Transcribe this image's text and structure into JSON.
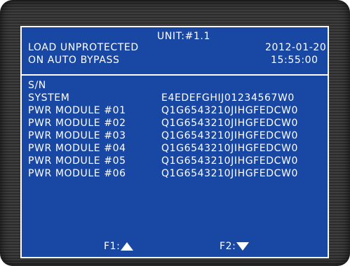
{
  "header": {
    "unit": "UNIT:#1.1",
    "alarm_line1": "LOAD UNPROTECTED",
    "alarm_line2": "ON AUTO BYPASS",
    "date": "2012-01-20",
    "time": "15:55:00"
  },
  "serial_list": {
    "title": "S/N",
    "rows": [
      {
        "label": "SYSTEM",
        "value": "E4EDEFGHIJ01234567W0"
      },
      {
        "label": "PWR MODULE #01",
        "value": "Q1G6543210JIHGFEDCW0"
      },
      {
        "label": "PWR MODULE #02",
        "value": "Q1G6543210JIHGFEDCW0"
      },
      {
        "label": "PWR MODULE #03",
        "value": "Q1G6543210JIHGFEDCW0"
      },
      {
        "label": "PWR MODULE #04",
        "value": "Q1G6543210JIHGFEDCW0"
      },
      {
        "label": "PWR MODULE #05",
        "value": "Q1G6543210JIHGFEDCW0"
      },
      {
        "label": "PWR MODULE #06",
        "value": "Q1G6543210JIHGFEDCW0"
      }
    ]
  },
  "function_keys": {
    "f1_label": "F1:",
    "f1_icon": "up-arrow-icon",
    "f2_label": "F2:",
    "f2_icon": "down-arrow-icon"
  },
  "colors": {
    "screen_background": "#1848a3",
    "text": "#ffffff",
    "bezel": "#333333"
  }
}
